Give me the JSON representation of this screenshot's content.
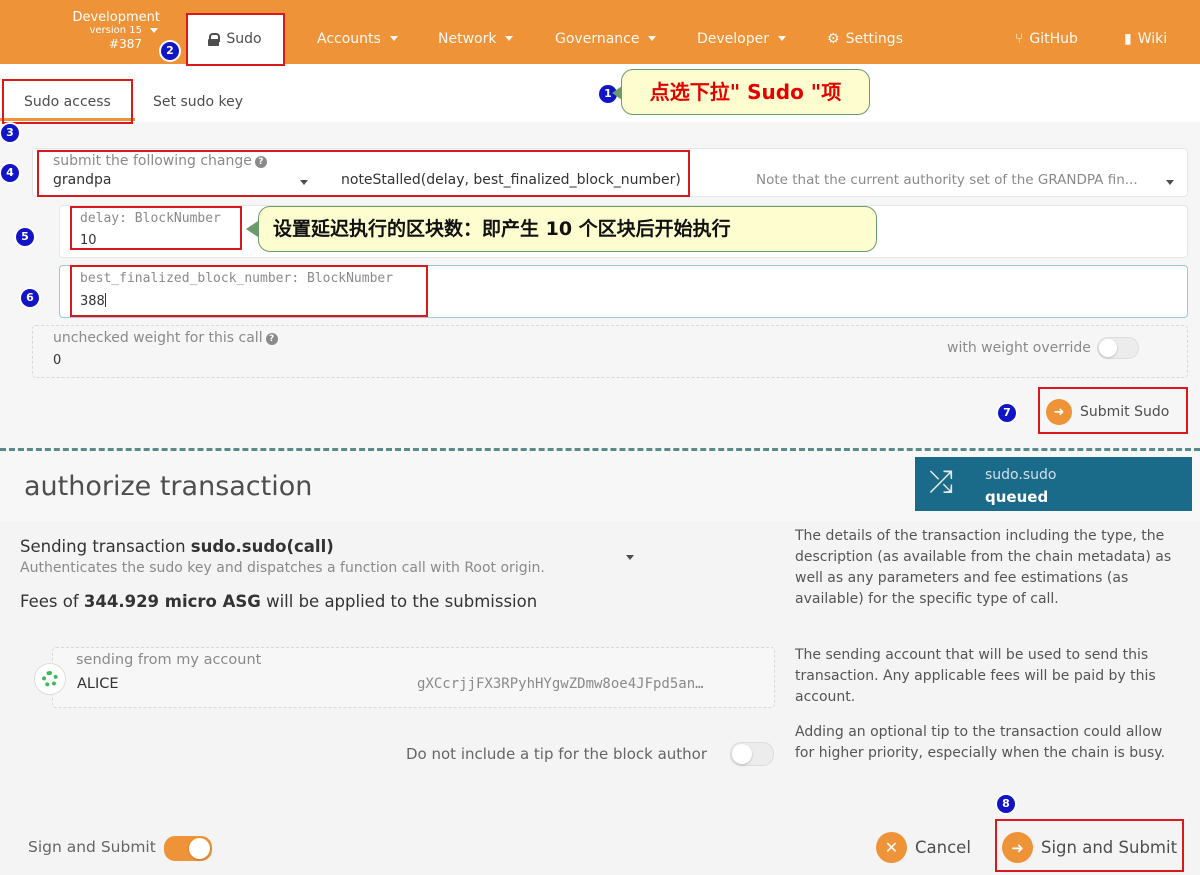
{
  "nav": {
    "chain_name": "Development",
    "version": "version 15",
    "block": "#387",
    "sudo": "Sudo",
    "items": [
      "Accounts",
      "Network",
      "Governance",
      "Developer",
      "Settings",
      "GitHub",
      "Wiki"
    ],
    "accent": "#ee9337"
  },
  "subtabs": {
    "sudo_access": "Sudo access",
    "set_sudo_key": "Set sudo key"
  },
  "annotations": {
    "callout1": "点选下拉\" Sudo \"项",
    "callout2": "设置延迟执行的区块数：即产生 10 个区块后开始执行",
    "badges": [
      "1",
      "2",
      "3",
      "4",
      "5",
      "6",
      "7",
      "8"
    ],
    "highlight_color": "#d9191c"
  },
  "form": {
    "submit_label": "submit the following change",
    "pallet": "grandpa",
    "method": "noteStalled(delay, best_finalized_block_number)",
    "method_doc": "Note that the current authority set of the GRANDPA fin...",
    "delay_label": "delay: BlockNumber",
    "delay_value": "10",
    "best_label": "best_finalized_block_number: BlockNumber",
    "best_value": "388",
    "weight_label": "unchecked weight for this call",
    "weight_value": "0",
    "weight_override": "with weight override",
    "submit_button": "Submit Sudo"
  },
  "modal": {
    "title": "authorize transaction",
    "status_call": "sudo.sudo",
    "status_state": "queued",
    "sending_prefix": "Sending transaction ",
    "sending_call": "sudo.sudo(call)",
    "sending_desc": "Authenticates the sudo key and dispatches a function call with Root origin.",
    "fees_prefix": "Fees of ",
    "fees_amount": "344.929 micro ASG",
    "fees_suffix": " will be applied to the submission",
    "from_label": "sending from my account",
    "account_name": "ALICE",
    "account_address": "gXCcrjjFX3RPyhHYgwZDmw8oe4JFpd5an…",
    "tip_label": "Do not include a tip for the block author",
    "help1": "The details of the transaction including the type, the description (as available from the chain metadata) as well as any parameters and fee estimations (as available) for the specific type of call.",
    "help2": "The sending account that will be used to send this transaction. Any applicable fees will be paid by this account.",
    "help3": "Adding an optional tip to the transaction could allow for higher priority, especially when the chain is busy.",
    "sign_toggle_label": "Sign and Submit",
    "cancel": "Cancel",
    "sign_submit": "Sign and Submit",
    "status_color": "#1a6a8a"
  }
}
